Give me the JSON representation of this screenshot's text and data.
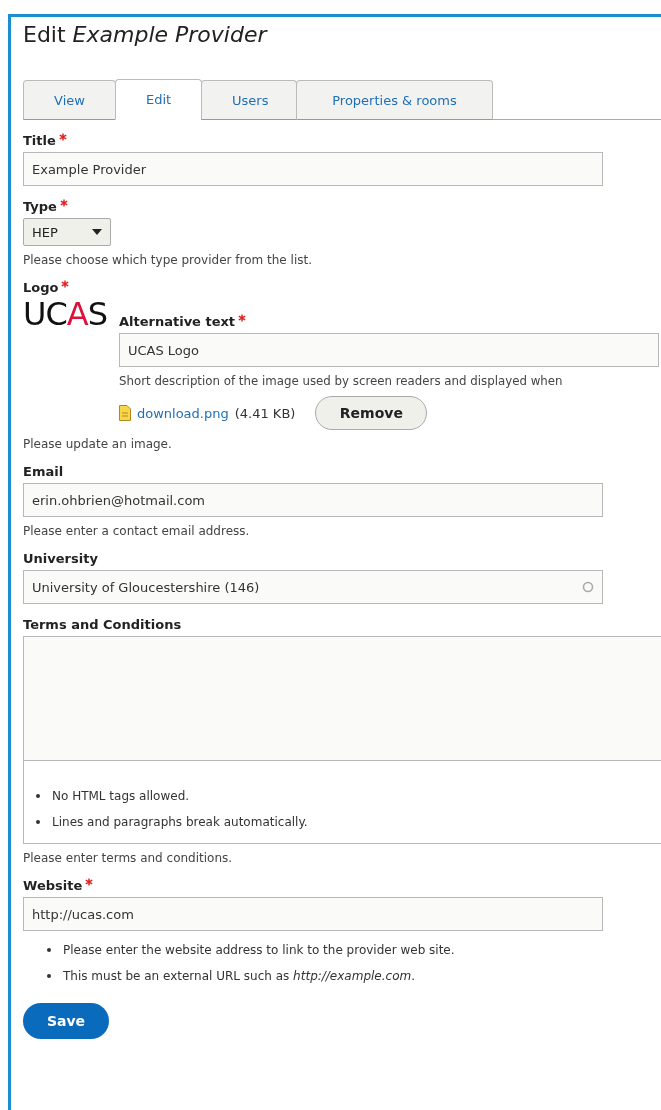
{
  "heading": "Edit *Example Provider*",
  "tabs": [
    {
      "label": "View",
      "selected": false
    },
    {
      "label": "Edit",
      "selected": true
    },
    {
      "label": "Users",
      "selected": false
    },
    {
      "label": "Properties & rooms",
      "selected": false
    }
  ],
  "fields": [
    {
      "kind": "text",
      "label": "Title",
      "required": true,
      "value": "Example Provider"
    },
    {
      "kind": "select",
      "label": "Type",
      "required": true,
      "value": "HEP",
      "help": "Please choose which type provider from the list."
    },
    {
      "kind": "image",
      "label": "Logo",
      "required": true,
      "logo_text": "UCAS",
      "alt_label": "Alternative text",
      "alt_required": true,
      "alt_value": "UCAS Logo",
      "alt_help": "Short description of the image used by screen readers and displayed when",
      "file_name": "download.png",
      "file_size": "(4.41 KB)",
      "remove_button": "Remove",
      "help": "Please update an image."
    },
    {
      "kind": "text",
      "label": "Email",
      "required": false,
      "value": "erin.ohbrien@hotmail.com",
      "help": "Please enter a contact email address."
    },
    {
      "kind": "autocomplete",
      "label": "University",
      "required": false,
      "value": "University of Gloucestershire (146)"
    },
    {
      "kind": "textarea",
      "label": "Terms and Conditions",
      "required": false,
      "tips": [
        "No HTML tags allowed.",
        "Lines and paragraphs break automatically."
      ],
      "help": "Please enter terms and conditions."
    },
    {
      "kind": "text",
      "label": "Website",
      "required": true,
      "value": "http://ucas.com",
      "tips": [
        "Please enter the website address to link to the provider web site.",
        "This must be an external URL such as *http://example.com*."
      ]
    }
  ],
  "save_button": "Save"
}
